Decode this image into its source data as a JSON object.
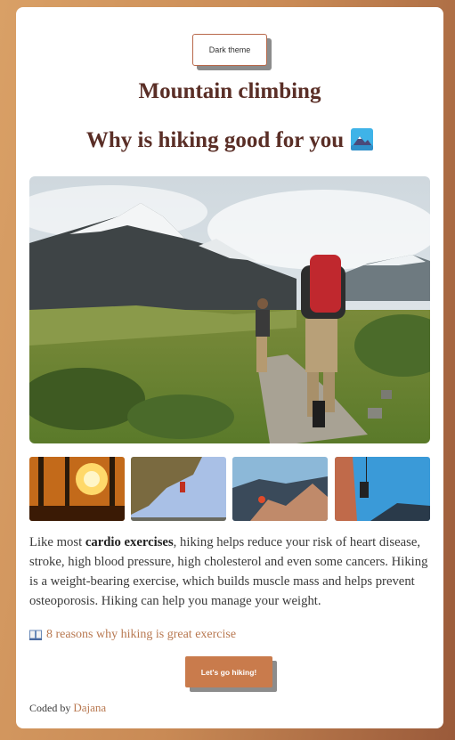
{
  "header": {
    "theme_button_label": "Dark theme",
    "title": "Mountain climbing",
    "subtitle": "Why is hiking good for you"
  },
  "icons": {
    "subtitle_emoji": "snow-capped-mountain-emoji-icon",
    "link_icon": "open-book-icon"
  },
  "images": {
    "hero": "hikers-on-mountain-trail",
    "thumbnails": [
      "sunset-silhouettes-in-forest",
      "climber-on-rock-overhang",
      "hikers-on-rocky-ridge",
      "climber-rappelling-cliff"
    ]
  },
  "body": {
    "text_before": "Like most ",
    "bold": "cardio exercises",
    "text_after": ", hiking helps reduce your risk of heart disease, stroke, high blood pressure, high cholesterol and even some cancers. Hiking is a weight-bearing exercise, which builds muscle mass and helps prevent osteoporosis. Hiking can help you manage your weight."
  },
  "link": {
    "label": "8 reasons why hiking is great exercise"
  },
  "cta": {
    "label": "Let's go hiking!"
  },
  "footer": {
    "prefix": "Coded by",
    "author": "Dajana"
  },
  "colors": {
    "heading": "#5a2e26",
    "accent": "#c97b4c",
    "link": "#b87850"
  }
}
